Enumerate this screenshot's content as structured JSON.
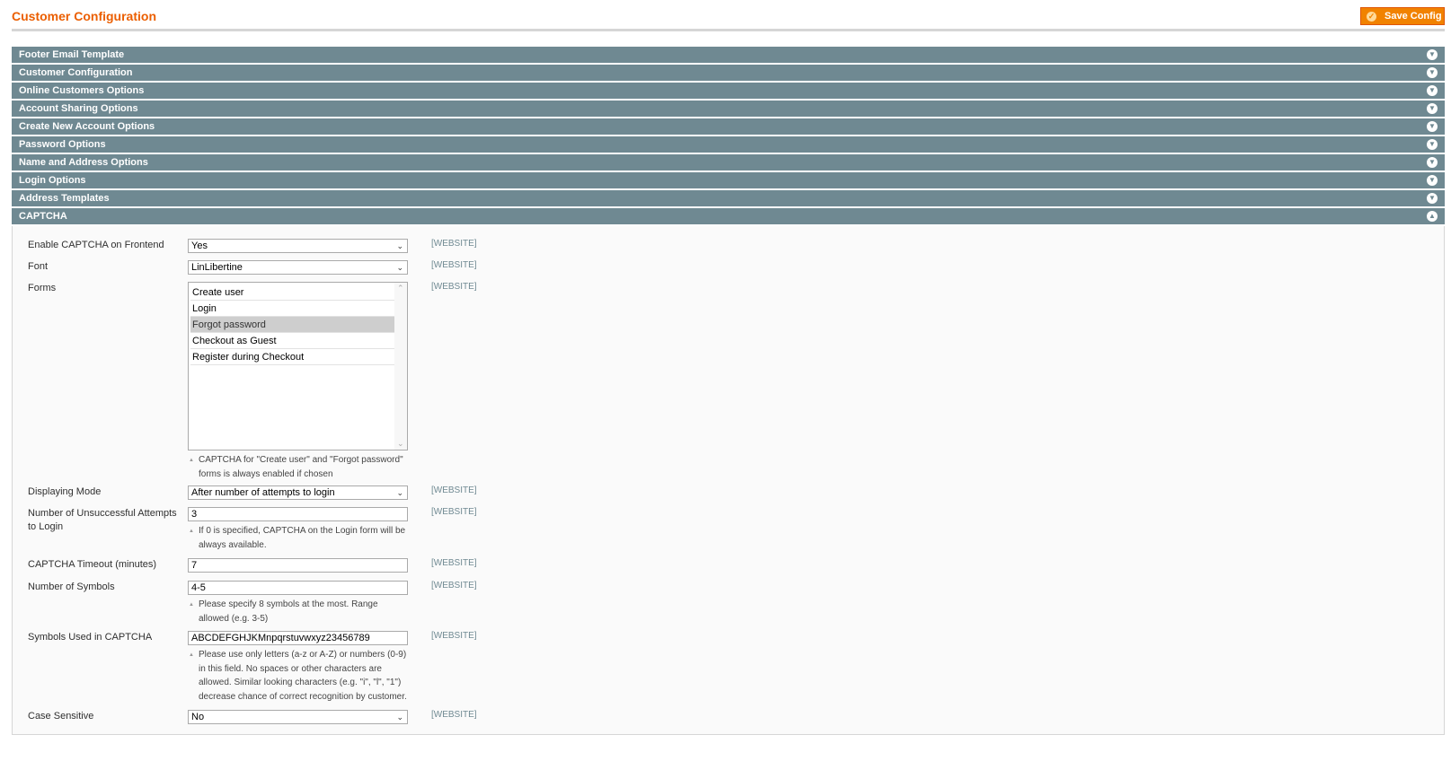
{
  "page": {
    "title": "Customer Configuration",
    "save_label": "Save Config"
  },
  "sections": [
    {
      "label": "Footer Email Template",
      "state": "collapsed"
    },
    {
      "label": "Customer Configuration",
      "state": "collapsed"
    },
    {
      "label": "Online Customers Options",
      "state": "collapsed"
    },
    {
      "label": "Account Sharing Options",
      "state": "collapsed"
    },
    {
      "label": "Create New Account Options",
      "state": "collapsed"
    },
    {
      "label": "Password Options",
      "state": "collapsed"
    },
    {
      "label": "Name and Address Options",
      "state": "collapsed"
    },
    {
      "label": "Login Options",
      "state": "collapsed"
    },
    {
      "label": "Address Templates",
      "state": "collapsed"
    },
    {
      "label": "CAPTCHA",
      "state": "expanded"
    }
  ],
  "captcha": {
    "scope": "[WEBSITE]",
    "enable": {
      "label": "Enable CAPTCHA on Frontend",
      "value": "Yes"
    },
    "font": {
      "label": "Font",
      "value": "LinLibertine"
    },
    "forms": {
      "label": "Forms",
      "options": [
        "Create user",
        "Login",
        "Forgot password",
        "Checkout as Guest",
        "Register during Checkout"
      ],
      "selected": [
        "Forgot password"
      ],
      "note": "CAPTCHA for \"Create user\" and \"Forgot password\" forms is always enabled if chosen"
    },
    "mode": {
      "label": "Displaying Mode",
      "value": "After number of attempts to login"
    },
    "attempts": {
      "label": "Number of Unsuccessful Attempts to Login",
      "value": "3",
      "note": "If 0 is specified, CAPTCHA on the Login form will be always available."
    },
    "timeout": {
      "label": "CAPTCHA Timeout (minutes)",
      "value": "7"
    },
    "symbols_count": {
      "label": "Number of Symbols",
      "value": "4-5",
      "note": "Please specify 8 symbols at the most. Range allowed (e.g. 3-5)"
    },
    "symbols": {
      "label": "Symbols Used in CAPTCHA",
      "value": "ABCDEFGHJKMnpqrstuvwxyz23456789",
      "note": "Please use only letters (a-z or A-Z) or numbers (0-9) in this field. No spaces or other characters are allowed. Similar looking characters (e.g. \"i\", \"l\", \"1\") decrease chance of correct recognition by customer."
    },
    "case_sensitive": {
      "label": "Case Sensitive",
      "value": "No"
    }
  },
  "icons": {
    "save": "checkmark-icon",
    "collapsed": "chevron-down-circle-icon",
    "expanded": "chevron-up-circle-icon"
  },
  "colors": {
    "accent": "#eb5e00",
    "button": "#f18200",
    "section_header": "#6f8992"
  }
}
